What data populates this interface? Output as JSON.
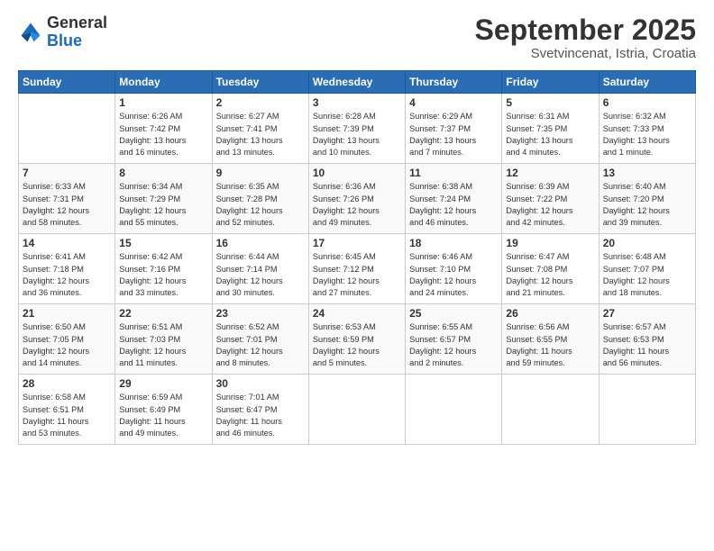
{
  "header": {
    "logo_general": "General",
    "logo_blue": "Blue",
    "month_title": "September 2025",
    "subtitle": "Svetvincenat, Istria, Croatia"
  },
  "days_of_week": [
    "Sunday",
    "Monday",
    "Tuesday",
    "Wednesday",
    "Thursday",
    "Friday",
    "Saturday"
  ],
  "weeks": [
    [
      {
        "day": "",
        "info": ""
      },
      {
        "day": "1",
        "info": "Sunrise: 6:26 AM\nSunset: 7:42 PM\nDaylight: 13 hours\nand 16 minutes."
      },
      {
        "day": "2",
        "info": "Sunrise: 6:27 AM\nSunset: 7:41 PM\nDaylight: 13 hours\nand 13 minutes."
      },
      {
        "day": "3",
        "info": "Sunrise: 6:28 AM\nSunset: 7:39 PM\nDaylight: 13 hours\nand 10 minutes."
      },
      {
        "day": "4",
        "info": "Sunrise: 6:29 AM\nSunset: 7:37 PM\nDaylight: 13 hours\nand 7 minutes."
      },
      {
        "day": "5",
        "info": "Sunrise: 6:31 AM\nSunset: 7:35 PM\nDaylight: 13 hours\nand 4 minutes."
      },
      {
        "day": "6",
        "info": "Sunrise: 6:32 AM\nSunset: 7:33 PM\nDaylight: 13 hours\nand 1 minute."
      }
    ],
    [
      {
        "day": "7",
        "info": "Sunrise: 6:33 AM\nSunset: 7:31 PM\nDaylight: 12 hours\nand 58 minutes."
      },
      {
        "day": "8",
        "info": "Sunrise: 6:34 AM\nSunset: 7:29 PM\nDaylight: 12 hours\nand 55 minutes."
      },
      {
        "day": "9",
        "info": "Sunrise: 6:35 AM\nSunset: 7:28 PM\nDaylight: 12 hours\nand 52 minutes."
      },
      {
        "day": "10",
        "info": "Sunrise: 6:36 AM\nSunset: 7:26 PM\nDaylight: 12 hours\nand 49 minutes."
      },
      {
        "day": "11",
        "info": "Sunrise: 6:38 AM\nSunset: 7:24 PM\nDaylight: 12 hours\nand 46 minutes."
      },
      {
        "day": "12",
        "info": "Sunrise: 6:39 AM\nSunset: 7:22 PM\nDaylight: 12 hours\nand 42 minutes."
      },
      {
        "day": "13",
        "info": "Sunrise: 6:40 AM\nSunset: 7:20 PM\nDaylight: 12 hours\nand 39 minutes."
      }
    ],
    [
      {
        "day": "14",
        "info": "Sunrise: 6:41 AM\nSunset: 7:18 PM\nDaylight: 12 hours\nand 36 minutes."
      },
      {
        "day": "15",
        "info": "Sunrise: 6:42 AM\nSunset: 7:16 PM\nDaylight: 12 hours\nand 33 minutes."
      },
      {
        "day": "16",
        "info": "Sunrise: 6:44 AM\nSunset: 7:14 PM\nDaylight: 12 hours\nand 30 minutes."
      },
      {
        "day": "17",
        "info": "Sunrise: 6:45 AM\nSunset: 7:12 PM\nDaylight: 12 hours\nand 27 minutes."
      },
      {
        "day": "18",
        "info": "Sunrise: 6:46 AM\nSunset: 7:10 PM\nDaylight: 12 hours\nand 24 minutes."
      },
      {
        "day": "19",
        "info": "Sunrise: 6:47 AM\nSunset: 7:08 PM\nDaylight: 12 hours\nand 21 minutes."
      },
      {
        "day": "20",
        "info": "Sunrise: 6:48 AM\nSunset: 7:07 PM\nDaylight: 12 hours\nand 18 minutes."
      }
    ],
    [
      {
        "day": "21",
        "info": "Sunrise: 6:50 AM\nSunset: 7:05 PM\nDaylight: 12 hours\nand 14 minutes."
      },
      {
        "day": "22",
        "info": "Sunrise: 6:51 AM\nSunset: 7:03 PM\nDaylight: 12 hours\nand 11 minutes."
      },
      {
        "day": "23",
        "info": "Sunrise: 6:52 AM\nSunset: 7:01 PM\nDaylight: 12 hours\nand 8 minutes."
      },
      {
        "day": "24",
        "info": "Sunrise: 6:53 AM\nSunset: 6:59 PM\nDaylight: 12 hours\nand 5 minutes."
      },
      {
        "day": "25",
        "info": "Sunrise: 6:55 AM\nSunset: 6:57 PM\nDaylight: 12 hours\nand 2 minutes."
      },
      {
        "day": "26",
        "info": "Sunrise: 6:56 AM\nSunset: 6:55 PM\nDaylight: 11 hours\nand 59 minutes."
      },
      {
        "day": "27",
        "info": "Sunrise: 6:57 AM\nSunset: 6:53 PM\nDaylight: 11 hours\nand 56 minutes."
      }
    ],
    [
      {
        "day": "28",
        "info": "Sunrise: 6:58 AM\nSunset: 6:51 PM\nDaylight: 11 hours\nand 53 minutes."
      },
      {
        "day": "29",
        "info": "Sunrise: 6:59 AM\nSunset: 6:49 PM\nDaylight: 11 hours\nand 49 minutes."
      },
      {
        "day": "30",
        "info": "Sunrise: 7:01 AM\nSunset: 6:47 PM\nDaylight: 11 hours\nand 46 minutes."
      },
      {
        "day": "",
        "info": ""
      },
      {
        "day": "",
        "info": ""
      },
      {
        "day": "",
        "info": ""
      },
      {
        "day": "",
        "info": ""
      }
    ]
  ]
}
